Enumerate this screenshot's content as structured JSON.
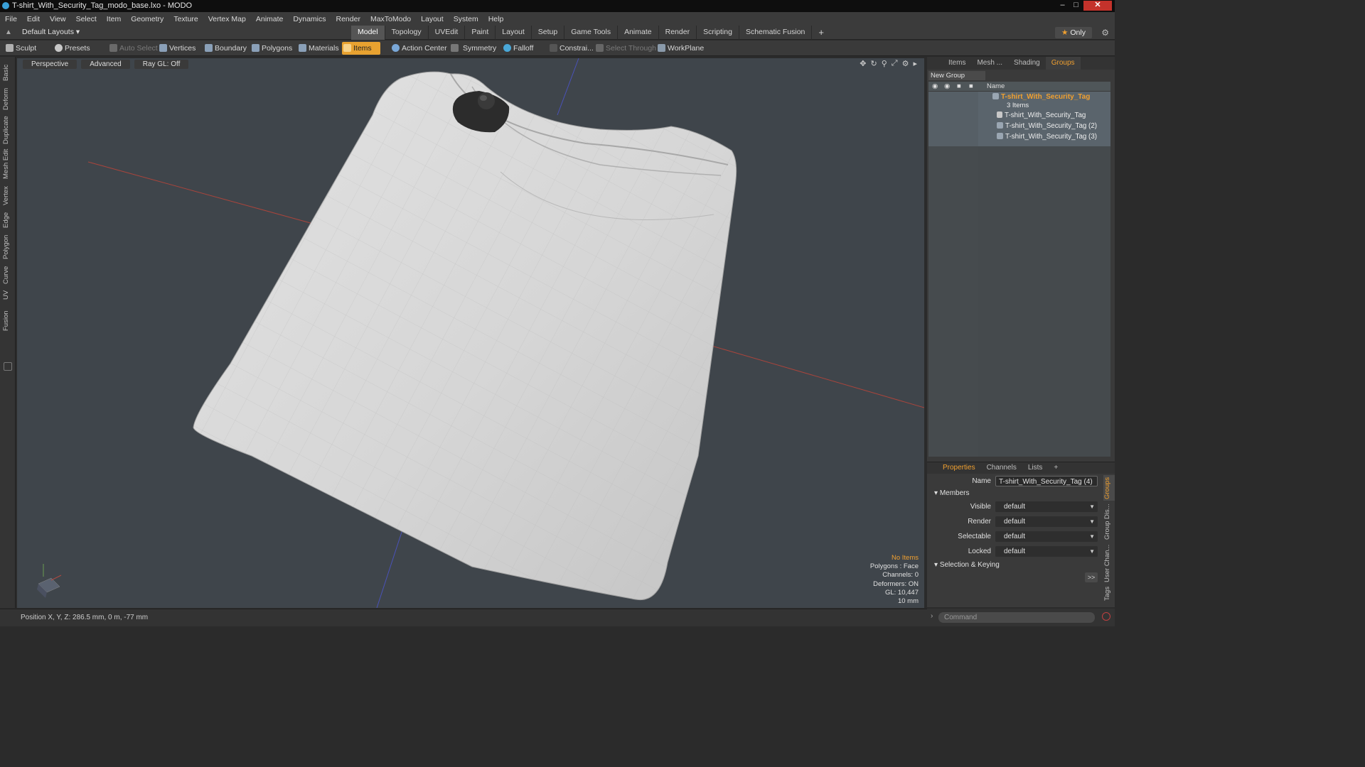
{
  "window": {
    "title": "T-shirt_With_Security_Tag_modo_base.lxo - MODO"
  },
  "menu": [
    "File",
    "Edit",
    "View",
    "Select",
    "Item",
    "Geometry",
    "Texture",
    "Vertex Map",
    "Animate",
    "Dynamics",
    "Render",
    "MaxToModo",
    "Layout",
    "System",
    "Help"
  ],
  "layout_bar": {
    "layouts_label": "Default Layouts",
    "tabs": [
      "Model",
      "Topology",
      "UVEdit",
      "Paint",
      "Layout",
      "Setup",
      "Game Tools",
      "Animate",
      "Render",
      "Scripting",
      "Schematic Fusion"
    ],
    "active_tab": "Model",
    "only_label": "Only",
    "add_label": "+"
  },
  "toolbar": {
    "sculpt": "Sculpt",
    "presets": "Presets",
    "auto_select": "Auto Select",
    "vertices": "Vertices",
    "boundary": "Boundary",
    "polygons": "Polygons",
    "materials": "Materials",
    "items": "Items",
    "action_center": "Action Center",
    "symmetry": "Symmetry",
    "falloff": "Falloff",
    "constraints": "Constrai...",
    "select_through": "Select Through",
    "workplane": "WorkPlane"
  },
  "left_tabs": [
    "Basic",
    "Deform",
    "Duplicate",
    "Mesh Edit",
    "Vertex",
    "Edge",
    "Polygon",
    "Curve",
    "UV",
    "Fusion"
  ],
  "viewport": {
    "view": "Perspective",
    "shading": "Advanced",
    "raygl": "Ray GL: Off",
    "hud": [
      "No Items",
      "Polygons : Face",
      "Channels: 0",
      "Deformers: ON",
      "GL: 10,447",
      "10 mm"
    ]
  },
  "status": {
    "position": "Position X, Y, Z:   286.5 mm, 0 m, -77 mm"
  },
  "items_panel": {
    "tabs": [
      "Items",
      "Mesh ...",
      "Shading",
      "Groups"
    ],
    "active_tab": "Groups",
    "new_group": "New Group",
    "column_name": "Name",
    "group_name": "T-shirt_With_Security_Tag",
    "group_count": "3 Items",
    "children": [
      "T-shirt_With_Security_Tag",
      "T-shirt_With_Security_Tag (2)",
      "T-shirt_With_Security_Tag (3)"
    ]
  },
  "properties": {
    "tabs": [
      "Properties",
      "Channels",
      "Lists",
      "+"
    ],
    "active_tab": "Properties",
    "name_label": "Name",
    "name_value": "T-shirt_With_Security_Tag (4)",
    "members_label": "Members",
    "rows": [
      {
        "label": "Visible",
        "value": "default"
      },
      {
        "label": "Render",
        "value": "default"
      },
      {
        "label": "Selectable",
        "value": "default"
      },
      {
        "label": "Locked",
        "value": "default"
      }
    ],
    "selection_keying": "Selection & Keying",
    "more": ">>",
    "side_tabs": [
      "Groups",
      "Group Dis...",
      "User Chan...",
      "Tags"
    ]
  },
  "command": {
    "placeholder": "Command"
  },
  "colors": {
    "accent": "#f0a030",
    "viewport_bg": "#3f454b",
    "axis_x": "#c03a30",
    "axis_z": "#3a48c0"
  }
}
